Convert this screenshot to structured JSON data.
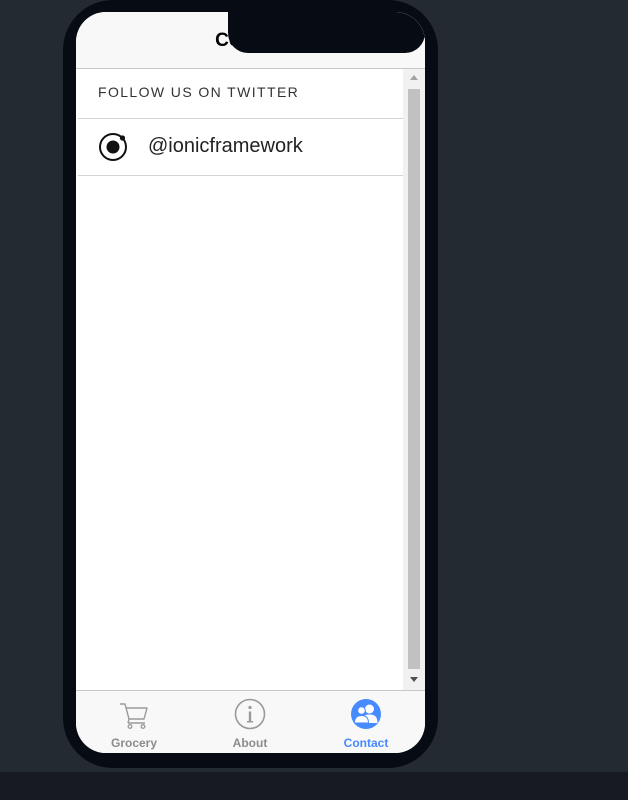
{
  "header": {
    "title": "Contact"
  },
  "section": {
    "header": "FOLLOW US ON TWITTER"
  },
  "twitter": {
    "handle": "@ionicframework",
    "icon": "ionic-logo-icon"
  },
  "tabs": [
    {
      "label": "Grocery",
      "icon": "cart-icon",
      "active": false
    },
    {
      "label": "About",
      "icon": "info-icon",
      "active": false
    },
    {
      "label": "Contact",
      "icon": "contacts-icon",
      "active": true
    }
  ],
  "colors": {
    "accent": "#488aff",
    "inactive": "#8c8c8c",
    "background": "#242a32",
    "device": "#060b14"
  }
}
